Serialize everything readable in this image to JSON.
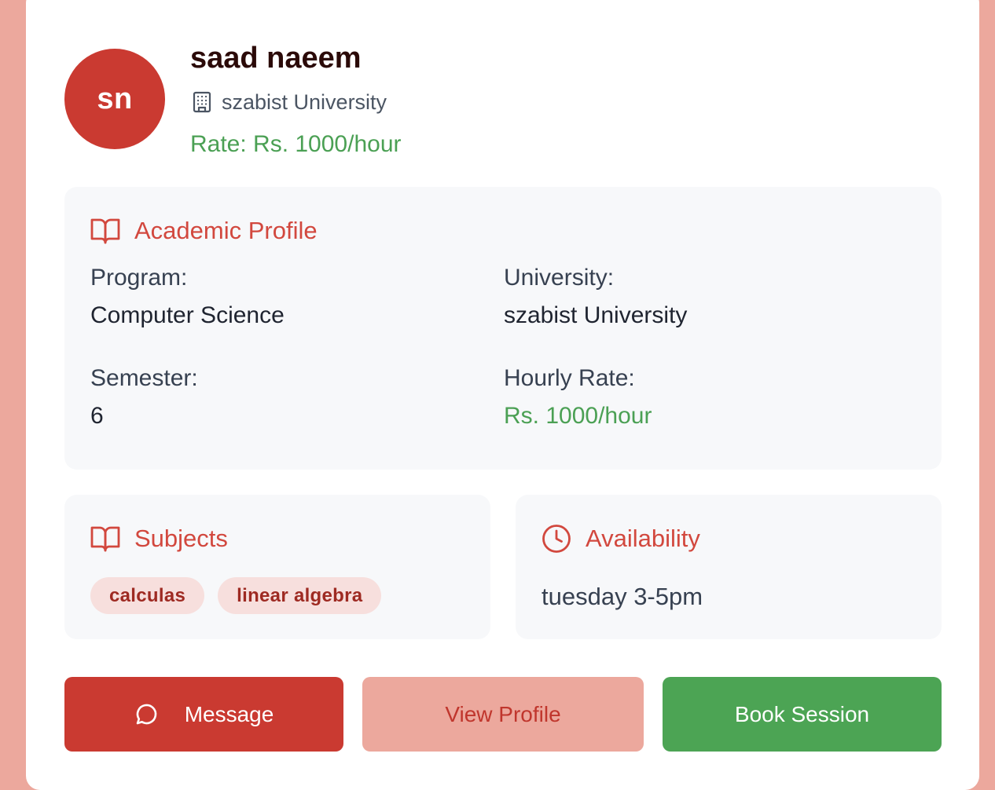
{
  "tutor": {
    "initials": "sn",
    "name": "saad naeem",
    "university": "szabist University",
    "rate": "Rate: Rs. 1000/hour"
  },
  "academic": {
    "title": "Academic Profile",
    "program_label": "Program:",
    "program_value": "Computer Science",
    "university_label": "University:",
    "university_value": "szabist University",
    "semester_label": "Semester:",
    "semester_value": "6",
    "hourly_label": "Hourly Rate:",
    "hourly_value": "Rs. 1000/hour"
  },
  "subjects": {
    "title": "Subjects",
    "items": [
      "calculas",
      "linear algebra"
    ]
  },
  "availability": {
    "title": "Availability",
    "text": "tuesday 3-5pm"
  },
  "actions": {
    "message": "Message",
    "view_profile": "View Profile",
    "book_session": "Book Session"
  },
  "icons": {
    "university": "building-icon",
    "academic": "book-open-icon",
    "subjects": "book-open-icon",
    "availability": "clock-icon",
    "message": "message-circle-icon"
  },
  "colors": {
    "primary_red": "#ca3a31",
    "title_red": "#d2483e",
    "green": "#4ba054",
    "background": "#eca89d",
    "panel": "#f7f8fa",
    "chip_bg": "#f7dfdd",
    "chip_text": "#9e2a22"
  }
}
